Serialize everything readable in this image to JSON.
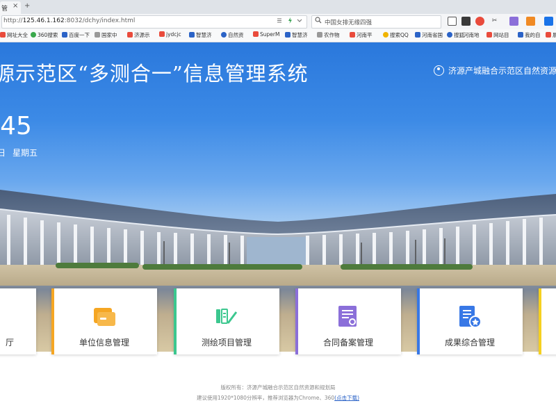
{
  "browser": {
    "tab_title": "管",
    "tab_buttons": [
      "×",
      "+"
    ],
    "url_host": "125.46.1.162",
    "url_prefix": "http://",
    "url_suffix": ":8032/dchy/index.html",
    "search_text": "中国女排无缘四强",
    "bookmarks": [
      "网址大全",
      "360搜索",
      "百度一下",
      "国家中",
      "济源示",
      "jydcjc",
      "智慧济",
      "自然资",
      "SuperM",
      "智慧济",
      "农作物",
      "河南平",
      "搜索QQ",
      "河南省国",
      "搜狐",
      "河南地",
      "网站目",
      "我的自",
      "展"
    ],
    "colors": {
      "accent": "#2b7de9"
    }
  },
  "hero": {
    "title": "源示范区“多测合一”信息管理系统",
    "user_label": "济源产城融合示范区自然资源和",
    "clock": ":45",
    "date": "日",
    "weekday": "星期五"
  },
  "cards": [
    {
      "label": "厅",
      "icon": "hall-icon",
      "color": "#2b7de9"
    },
    {
      "label": "单位信息管理",
      "icon": "folder-card-icon",
      "color": "#f5a623"
    },
    {
      "label": "测绘项目管理",
      "icon": "survey-edit-icon",
      "color": "#3cc78f"
    },
    {
      "label": "合同备案管理",
      "icon": "contract-doc-icon",
      "color": "#8b6fd9"
    },
    {
      "label": "成果综合管理",
      "icon": "results-folder-icon",
      "color": "#3878e6"
    },
    {
      "label": "",
      "icon": "",
      "color": "#f5d020"
    }
  ],
  "footer": {
    "line1": "版权所有：济源产城融合示范区自然资源和规划局",
    "line2": "建议使用1920*1080分辨率，推荐浏览器为Chrome、360",
    "download_link": "(点击下载)"
  }
}
